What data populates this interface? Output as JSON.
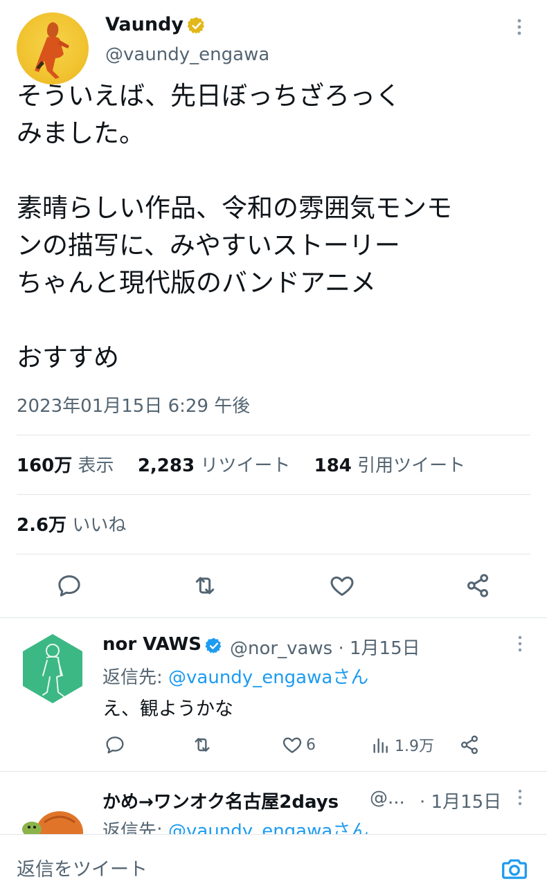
{
  "main_tweet": {
    "author_name": "Vaundy",
    "author_handle": "@vaundy_engawa",
    "text": "そういえば、先日ぼっちざろっく\nみました。\n\n素晴らしい作品、令和の雰囲気モンモ\nンの描写に、みやすいストーリー\nちゃんと現代版のバンドアニメ\n\nおすすめ",
    "timestamp": "2023年01月15日 6:29 午後",
    "stats": {
      "views_count": "160万",
      "views_label": "表示",
      "retweets_count": "2,283",
      "retweets_label": "リツイート",
      "quotes_count": "184",
      "quotes_label": "引用ツイート",
      "likes_count": "2.6万",
      "likes_label": "いいね"
    }
  },
  "replies": [
    {
      "name": "nor VAWS",
      "handle": "@nor_vaws · 1月15日",
      "reply_to_prefix": "返信先: ",
      "reply_to_handle": "@vaundy_engawaさん",
      "text": "え、観ようかな",
      "likes": "6",
      "views": "1.9万"
    },
    {
      "name": "かめ→ワンオク名古屋2days",
      "handle": "@...",
      "date": "· 1月15日",
      "reply_to_prefix": "返信先: ",
      "reply_to_handle": "@vaundy_engawaさん"
    }
  ],
  "compose": {
    "placeholder": "返信をツイート"
  },
  "colors": {
    "accent": "#1d9bf0",
    "verified_gold": "#e2b719",
    "verified_blue": "#1d9bf0",
    "secondary_text": "#536471"
  },
  "icons": [
    "verified-badge-icon",
    "more-icon",
    "reply-icon",
    "retweet-icon",
    "like-icon",
    "share-icon",
    "views-icon",
    "camera-icon"
  ]
}
